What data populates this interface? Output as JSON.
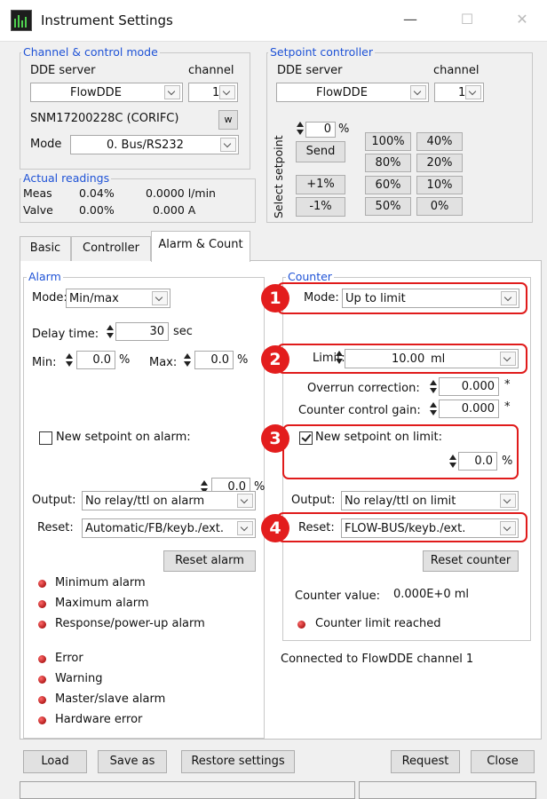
{
  "window": {
    "title": "Instrument Settings",
    "minimize": "—",
    "maximize": "☐",
    "close": "✕"
  },
  "channel": {
    "group": "Channel & control mode",
    "dde_label": "DDE server",
    "channel_label": "channel",
    "dde_value": "FlowDDE",
    "channel_value": "1",
    "serial": "SNM17200228C (CORIFC)",
    "w_button": "w",
    "mode_label": "Mode",
    "mode_value": "0. Bus/RS232"
  },
  "setpoint": {
    "group": "Setpoint controller",
    "dde_label": "DDE server",
    "channel_label": "channel",
    "dde_value": "FlowDDE",
    "channel_value": "1",
    "vertical_label": "Select setpoint",
    "value": "0",
    "unit": "%",
    "send": "Send",
    "plus": "+1%",
    "minus": "-1%",
    "presets": [
      "100%",
      "40%",
      "80%",
      "20%",
      "60%",
      "10%",
      "50%",
      "0%"
    ]
  },
  "readings": {
    "group": "Actual readings",
    "meas_label": "Meas",
    "meas_pct": "0.04%",
    "meas_val": "0.0000 l/min",
    "valve_label": "Valve",
    "valve_pct": "0.00%",
    "valve_val": "0.000 A"
  },
  "tabs": [
    "Basic",
    "Controller",
    "Alarm & Count"
  ],
  "alarm": {
    "group": "Alarm",
    "mode_label": "Mode:",
    "mode_value": "Min/max",
    "delay_label": "Delay time:",
    "delay_value": "30",
    "delay_unit": "sec",
    "min_label": "Min:",
    "min_value": "0.0",
    "min_unit": "%",
    "max_label": "Max:",
    "max_value": "0.0",
    "max_unit": "%",
    "new_sp_label": "New setpoint on alarm:",
    "new_sp_value": "0.0",
    "new_sp_unit": "%",
    "output_label": "Output:",
    "output_value": "No relay/ttl on alarm",
    "reset_label": "Reset:",
    "reset_value": "Automatic/FB/keyb./ext.",
    "reset_button": "Reset alarm",
    "leds": [
      "Minimum alarm",
      "Maximum alarm",
      "Response/power-up alarm"
    ],
    "leds2": [
      "Error",
      "Warning",
      "Master/slave alarm",
      "Hardware error"
    ]
  },
  "counter": {
    "group": "Counter",
    "mode_label": "Mode:",
    "mode_value": "Up to limit",
    "limit_label": "Limit:",
    "limit_value": "10.00",
    "limit_unit": "ml",
    "overrun_label": "Overrun correction:",
    "overrun_value": "0.000",
    "gain_label": "Counter control gain:",
    "gain_value": "0.000",
    "star": "*",
    "new_sp_label": "New setpoint on limit:",
    "new_sp_value": "0.0",
    "new_sp_unit": "%",
    "output_label": "Output:",
    "output_value": "No relay/ttl on limit",
    "reset_label": "Reset:",
    "reset_value": "FLOW-BUS/keyb./ext.",
    "reset_button": "Reset counter",
    "counter_value_label": "Counter value:",
    "counter_value": "0.000E+0 ml",
    "limit_reached": "Counter limit reached"
  },
  "connection": "Connected to FlowDDE channel 1",
  "badges": [
    "1",
    "2",
    "3",
    "4"
  ],
  "footer": {
    "load": "Load",
    "save_as": "Save as",
    "restore": "Restore settings",
    "request": "Request",
    "close": "Close"
  }
}
